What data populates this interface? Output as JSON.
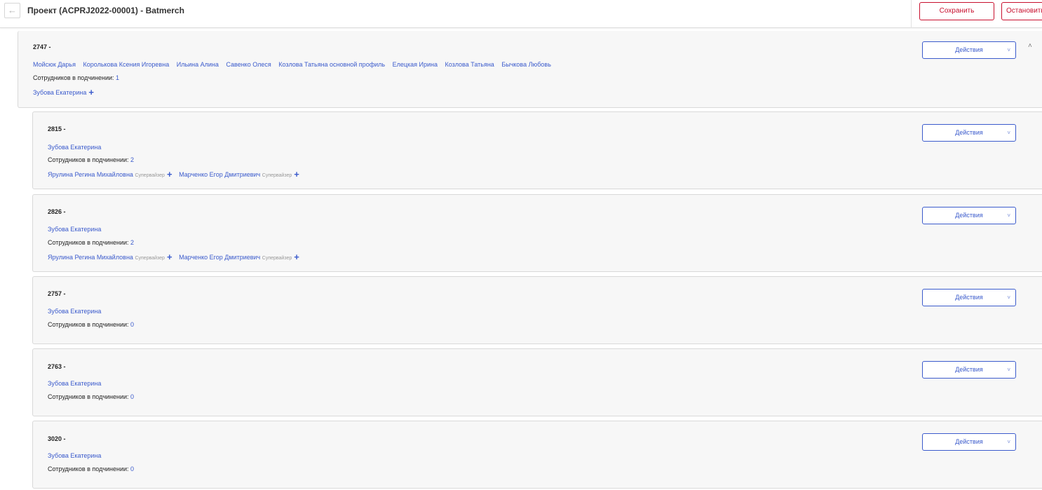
{
  "header": {
    "back_icon": "arrow-left-icon",
    "title": "Проект (ACPRJ2022-00001) - Batmerch",
    "save_label": "Сохранить",
    "stop_label": "Остановить"
  },
  "common": {
    "subordinates_label": "Сотрудников в подчинении: ",
    "actions_label": "Действия",
    "supervisor_label": "Супервайзер",
    "plus": "+",
    "chevron_down": "˅",
    "chevron_up": "˄"
  },
  "cards": [
    {
      "id": "2747 -",
      "employees": [
        "Мойсюк Дарья",
        "Королькова Ксения Игоревна",
        "Ильина Алина",
        "Савенко Олеся",
        "Козлова Татьяна основной профиль",
        "Елецкая Ирина",
        "Козлова Татьяна",
        "Бычкова Любовь"
      ],
      "subordinates": "1",
      "manager": "Зубова Екатерина"
    },
    {
      "id": "2815 -",
      "employee": "Зубова Екатерина",
      "subordinates": "2",
      "supervisors": [
        "Ярулина Регина Михайловна",
        "Марченко Егор Дмитриевич"
      ]
    },
    {
      "id": "2826 -",
      "employee": "Зубова Екатерина",
      "subordinates": "2",
      "supervisors": [
        "Ярулина Регина Михайловна",
        "Марченко Егор Дмитриевич"
      ]
    },
    {
      "id": "2757 -",
      "employee": "Зубова Екатерина",
      "subordinates": "0"
    },
    {
      "id": "2763 -",
      "employee": "Зубова Екатерина",
      "subordinates": "0"
    },
    {
      "id": "3020 -",
      "employee": "Зубова Екатерина",
      "subordinates": "0"
    }
  ]
}
